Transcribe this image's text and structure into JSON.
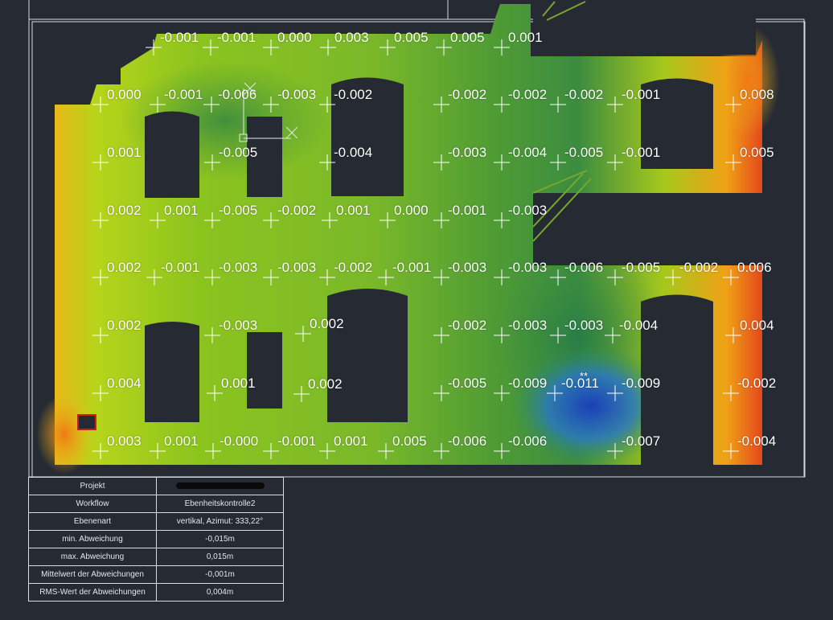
{
  "colors": {
    "background": "#252a33",
    "frame": "#e6e8ec",
    "scale": [
      "#1e50c8",
      "#2c8ad0",
      "#1f7a45",
      "#3e9a2c",
      "#86c21c",
      "#c8dc18",
      "#f0c814",
      "#f08a14",
      "#e0301e"
    ]
  },
  "measurements": [
    "-0.001",
    "-0.001",
    "0.000",
    "0.003",
    "0.005",
    "0.005",
    "0.001",
    "0.000",
    "-0.001",
    "-0.006",
    "-0.003",
    "-0.002",
    "-0.002",
    "-0.002",
    "-0.002",
    "-0.001",
    "0.008",
    "0.001",
    "-0.005",
    "-0.004",
    "-0.003",
    "-0.004",
    "-0.005",
    "-0.001",
    "0.005",
    "0.002",
    "0.001",
    "-0.005",
    "-0.002",
    "0.001",
    "0.000",
    "-0.001",
    "-0.003",
    "0.002",
    "-0.001",
    "-0.003",
    "-0.003",
    "-0.002",
    "-0.001",
    "-0.003",
    "-0.003",
    "-0.006",
    "-0.005",
    "-0.002",
    "0.006",
    "0.002",
    "-0.003",
    "0.002",
    "-0.002",
    "-0.003",
    "-0.003",
    "-0.004",
    "0.004",
    "0.004",
    "0.001",
    "0.002",
    "-0.005",
    "-0.009",
    "-0.011",
    "-0.009",
    "-0.002",
    "0.003",
    "0.001",
    "-0.000",
    "-0.001",
    "0.001",
    "0.005",
    "-0.006",
    "-0.006",
    "-0.007",
    "-0.004"
  ],
  "marker_text": "**",
  "info_table": {
    "rows": [
      {
        "label": "Projekt",
        "value": ""
      },
      {
        "label": "Workflow",
        "value": "Ebenheitskontrolle2"
      },
      {
        "label": "Ebenenart",
        "value": "vertikal, Azimut: 333,22°"
      },
      {
        "label": "min. Abweichung",
        "value": "-0,015m"
      },
      {
        "label": "max. Abweichung",
        "value": "0,015m"
      },
      {
        "label": "Mittelwert der Abweichungen",
        "value": "-0,001m"
      },
      {
        "label": "RMS-Wert der Abweichungen",
        "value": "0,004m"
      }
    ]
  }
}
